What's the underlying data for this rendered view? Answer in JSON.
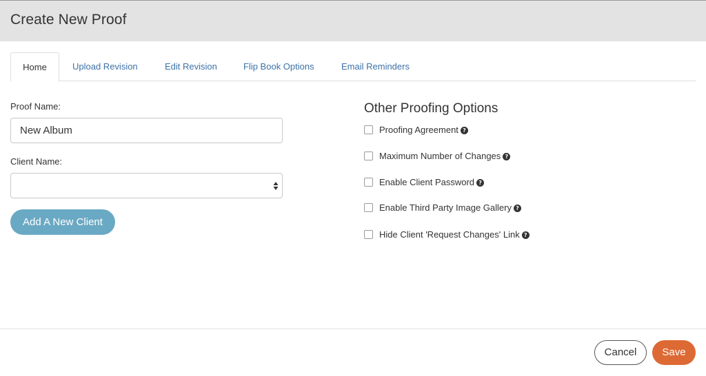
{
  "modal": {
    "title": "Create New Proof"
  },
  "tabs": [
    {
      "label": "Home",
      "active": true
    },
    {
      "label": "Upload Revision",
      "active": false
    },
    {
      "label": "Edit Revision",
      "active": false
    },
    {
      "label": "Flip Book Options",
      "active": false
    },
    {
      "label": "Email Reminders",
      "active": false
    }
  ],
  "form": {
    "proof_name_label": "Proof Name:",
    "proof_name_value": "New Album",
    "client_name_label": "Client Name:",
    "client_name_value": "",
    "add_client_label": "Add A New Client"
  },
  "options": {
    "title": "Other Proofing Options",
    "items": [
      {
        "label": "Proofing Agreement",
        "checked": false,
        "help_icon": "question-circle-icon"
      },
      {
        "label": "Maximum Number of Changes",
        "checked": false,
        "help_icon": "question-circle-icon"
      },
      {
        "label": "Enable Client Password",
        "checked": false,
        "help_icon": "question-circle-icon"
      },
      {
        "label": "Enable Third Party Image Gallery",
        "checked": false,
        "help_icon": "question-circle-icon"
      },
      {
        "label": "Hide Client 'Request Changes' Link",
        "checked": false,
        "help_icon": "question-circle-icon"
      }
    ]
  },
  "footer": {
    "cancel_label": "Cancel",
    "save_label": "Save"
  },
  "colors": {
    "header_bg": "#e3e3e3",
    "link": "#3c72a8",
    "add_button": "#6aa9c4",
    "save_button": "#dd6a34"
  }
}
